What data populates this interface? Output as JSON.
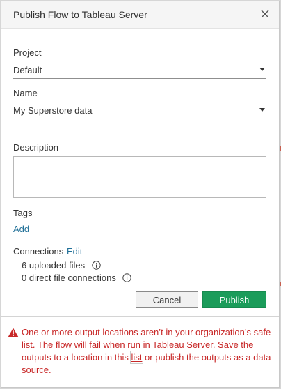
{
  "dialog": {
    "title": "Publish Flow to Tableau Server"
  },
  "project": {
    "label": "Project",
    "value": "Default"
  },
  "name": {
    "label": "Name",
    "value": "My Superstore data"
  },
  "description": {
    "label": "Description",
    "value": ""
  },
  "tags": {
    "label": "Tags",
    "add_link": "Add"
  },
  "connections": {
    "label": "Connections",
    "edit_link": "Edit",
    "uploaded_files": "6 uploaded files",
    "direct_connections": "0 direct file connections"
  },
  "buttons": {
    "cancel": "Cancel",
    "publish": "Publish"
  },
  "warning": {
    "text_before": "One or more output locations aren’t in your organization’s safe list. The flow will fail when run in Tableau Server. Save the outputs to a location in this ",
    "link": "list",
    "text_after": " or publish the outputs as a data source."
  },
  "colors": {
    "accent_green": "#1b9c5a",
    "link_blue": "#1f6f97",
    "warning_red": "#c82828"
  },
  "icons": {
    "close": "close-icon",
    "dropdown": "caret-down-icon",
    "info": "info-icon",
    "warning": "warning-icon"
  }
}
